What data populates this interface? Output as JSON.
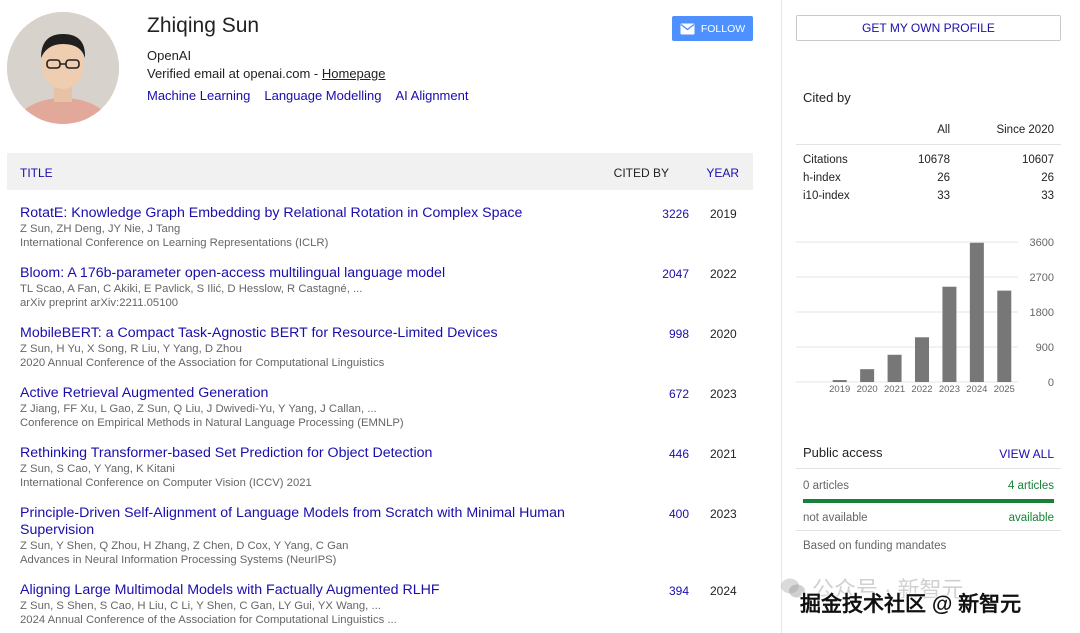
{
  "profile": {
    "name": "Zhiqing Sun",
    "affiliation": "OpenAI",
    "email_prefix": "Verified email at openai.com - ",
    "homepage_label": "Homepage",
    "interests": [
      "Machine Learning",
      "Language Modelling",
      "AI Alignment"
    ],
    "follow_label": "FOLLOW"
  },
  "table": {
    "col_title": "TITLE",
    "col_cited": "CITED BY",
    "col_year": "YEAR",
    "rows": [
      {
        "title": "RotatE: Knowledge Graph Embedding by Relational Rotation in Complex Space",
        "authors": "Z Sun, ZH Deng, JY Nie, J Tang",
        "venue": "International Conference on Learning Representations (ICLR)",
        "cited": "3226",
        "year": "2019"
      },
      {
        "title": "Bloom: A 176b-parameter open-access multilingual language model",
        "authors": "TL Scao, A Fan, C Akiki, E Pavlick, S Ilić, D Hesslow, R Castagné, ...",
        "venue": "arXiv preprint arXiv:2211.05100",
        "cited": "2047",
        "year": "2022"
      },
      {
        "title": "MobileBERT: a Compact Task-Agnostic BERT for Resource-Limited Devices",
        "authors": "Z Sun, H Yu, X Song, R Liu, Y Yang, D Zhou",
        "venue": "2020 Annual Conference of the Association for Computational Linguistics",
        "cited": "998",
        "year": "2020"
      },
      {
        "title": "Active Retrieval Augmented Generation",
        "authors": "Z Jiang, FF Xu, L Gao, Z Sun, Q Liu, J Dwivedi-Yu, Y Yang, J Callan, ...",
        "venue": "Conference on Empirical Methods in Natural Language Processing (EMNLP)",
        "cited": "672",
        "year": "2023"
      },
      {
        "title": "Rethinking Transformer-based Set Prediction for Object Detection",
        "authors": "Z Sun, S Cao, Y Yang, K Kitani",
        "venue": "International Conference on Computer Vision (ICCV) 2021",
        "cited": "446",
        "year": "2021"
      },
      {
        "title": "Principle-Driven Self-Alignment of Language Models from Scratch with Minimal Human Supervision",
        "authors": "Z Sun, Y Shen, Q Zhou, H Zhang, Z Chen, D Cox, Y Yang, C Gan",
        "venue": "Advances in Neural Information Processing Systems (NeurIPS)",
        "cited": "400",
        "year": "2023"
      },
      {
        "title": "Aligning Large Multimodal Models with Factually Augmented RLHF",
        "authors": "Z Sun, S Shen, S Cao, H Liu, C Li, Y Shen, C Gan, LY Gui, YX Wang, ...",
        "venue": "2024 Annual Conference of the Association for Computational Linguistics ...",
        "cited": "394",
        "year": "2024"
      }
    ]
  },
  "sidebar": {
    "get_profile_label": "GET MY OWN PROFILE",
    "cited_by_title": "Cited by",
    "col_all": "All",
    "col_since": "Since 2020",
    "stats": [
      {
        "label": "Citations",
        "all": "10678",
        "since": "10607"
      },
      {
        "label": "h-index",
        "all": "26",
        "since": "26"
      },
      {
        "label": "i10-index",
        "all": "33",
        "since": "33"
      }
    ],
    "public_access": {
      "title": "Public access",
      "view_all": "VIEW ALL",
      "left1": "0 articles",
      "right1": "4 articles",
      "left2": "not available",
      "right2": "available",
      "note": "Based on funding mandates",
      "available_fraction": 1.0
    }
  },
  "chart_data": {
    "type": "bar",
    "categories": [
      "2019",
      "2020",
      "2021",
      "2022",
      "2023",
      "2024",
      "2025"
    ],
    "values": [
      50,
      330,
      700,
      1150,
      2450,
      3580,
      2350
    ],
    "yticks": [
      0,
      900,
      1800,
      2700,
      3600
    ],
    "ylim": [
      0,
      3600
    ],
    "bar_color": "#777777"
  },
  "watermark": {
    "line1": "公众号 · 新智元",
    "line2": "掘金技术社区 @ 新智元"
  },
  "colors": {
    "link": "#1a0dab",
    "follow_button": "#4d90fe",
    "available_green": "#188038"
  }
}
